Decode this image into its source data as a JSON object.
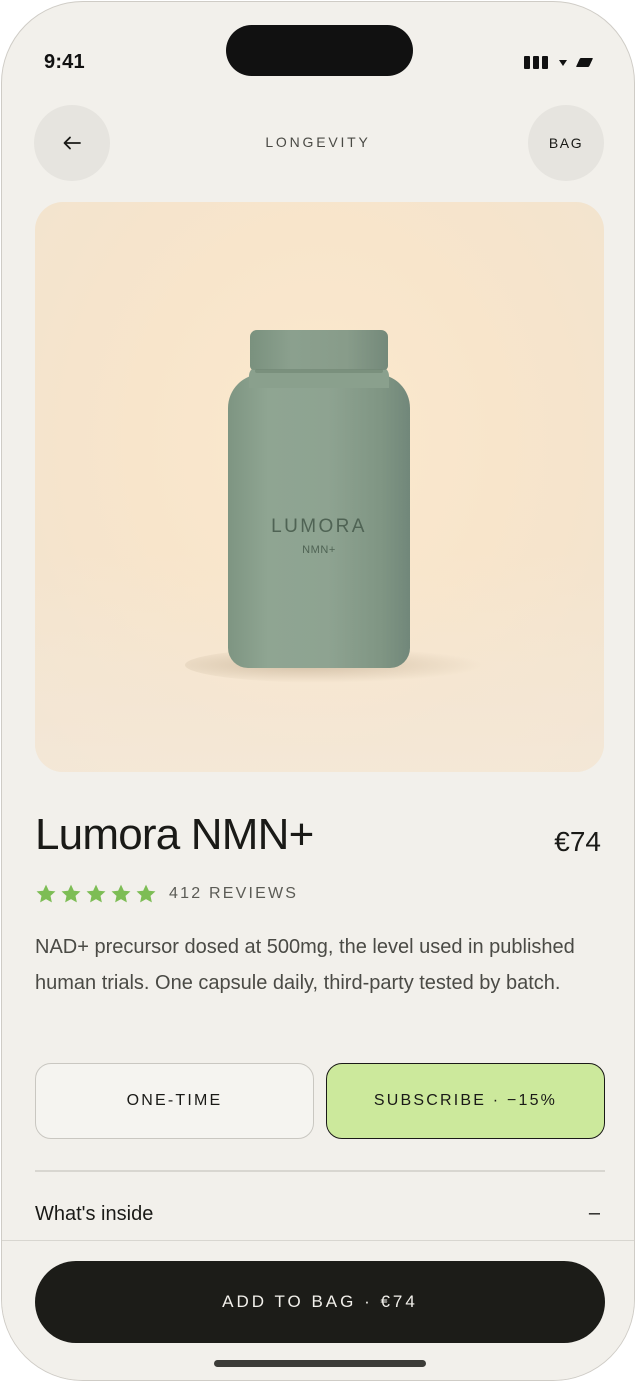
{
  "status_bar": {
    "time": "9:41"
  },
  "nav": {
    "back_icon": "arrow-left-icon",
    "title": "LONGEVITY",
    "bag_label": "BAG"
  },
  "hero": {
    "bottle_brand": "LUMORA",
    "bottle_sub": "NMN+"
  },
  "product": {
    "title": "Lumora NMN+",
    "price": "€74",
    "rating": 5,
    "rating_max": 5,
    "reviews_label": "412 REVIEWS",
    "description": "NAD+ precursor dosed at 500mg, the level used in published human trials. One capsule daily, third-party tested by batch."
  },
  "purchase_options": {
    "one_time_label": "ONE-TIME",
    "subscribe_label": "SUBSCRIBE · −15%",
    "selected": "subscribe"
  },
  "sections": {
    "whats_inside_label": "What's inside",
    "whats_inside_toggle": "–"
  },
  "cta": {
    "label": "ADD TO BAG · €74"
  },
  "colors": {
    "background": "#f2f0eb",
    "accent_green": "#cce99c",
    "star_green": "#7dbd55",
    "cta_dark": "#1c1c18"
  }
}
